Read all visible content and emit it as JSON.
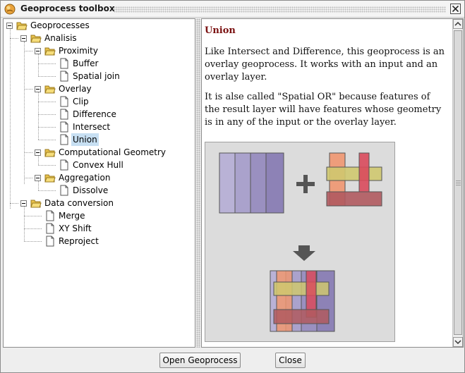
{
  "window": {
    "title": "Geoprocess toolbox"
  },
  "tree": {
    "root": "Geoprocesses",
    "analisis": "Analisis",
    "proximity": "Proximity",
    "buffer": "Buffer",
    "spatial_join": "Spatial join",
    "overlay": "Overlay",
    "clip": "Clip",
    "difference": "Difference",
    "intersect": "Intersect",
    "union": "Union",
    "computational_geometry": "Computational Geometry",
    "convex_hull": "Convex Hull",
    "aggregation": "Aggregation",
    "dissolve": "Dissolve",
    "data_conversion": "Data conversion",
    "merge": "Merge",
    "xy_shift": "XY Shift",
    "reproject": "Reproject",
    "selected": "Union"
  },
  "help": {
    "title": "Union",
    "paragraph1": "Like Intersect and Difference, this geoprocess is an overlay geoprocess. It works with an input and an overlay layer.",
    "paragraph2": "It is alse called \"Spatial OR\" because features of the result layer will have features whose geometry is in any of the input or the overlay layer."
  },
  "buttons": {
    "open_geoprocess": "Open Geoprocess",
    "close": "Close"
  },
  "colors": {
    "selection": "#c7dff2",
    "help_title": "#7a1010",
    "input_layer": "#9a90c0",
    "overlay_orange": "#ef9670",
    "overlay_yellow": "#cfc86f",
    "overlay_red": "#d94a5c",
    "overlay_darkred": "#b05a5f"
  }
}
